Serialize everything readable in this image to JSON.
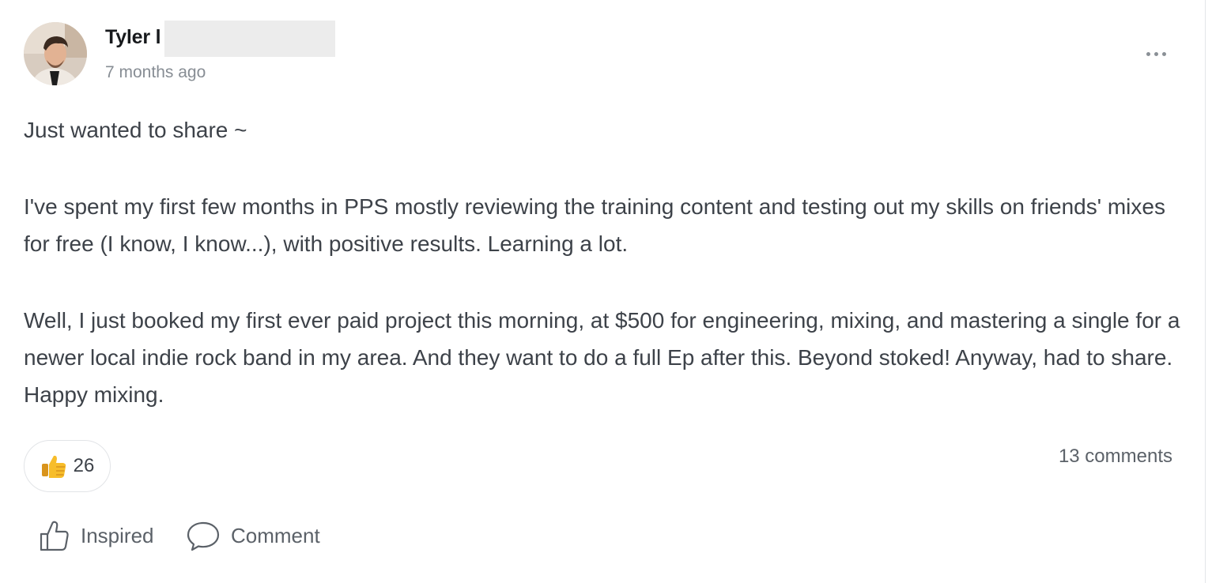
{
  "post": {
    "author": {
      "name": "Tyler l",
      "timestamp": "7 months ago",
      "avatar_icon": "user-avatar-photo"
    },
    "menu_icon": "more-horizontal-icon",
    "body": {
      "p1": "Just wanted to share ~",
      "p2": "I've spent my first few months in PPS mostly reviewing the training content and testing out my skills on friends' mixes for free (I know, I know...), with positive results. Learning a lot.",
      "p3": "Well, I just booked my first ever paid project this morning, at $500 for engineering, mixing, and mastering a single for a newer local indie rock band in my area. And they want to do a full Ep after this. Beyond stoked! Anyway, had to share. Happy mixing."
    },
    "reactions": {
      "icon": "thumbs-up-emoji",
      "count": "26"
    },
    "comments_count_label": "13 comments",
    "actions": {
      "inspired_label": "Inspired",
      "inspired_icon": "thumbs-up-outline-icon",
      "comment_label": "Comment",
      "comment_icon": "speech-bubble-icon"
    }
  }
}
